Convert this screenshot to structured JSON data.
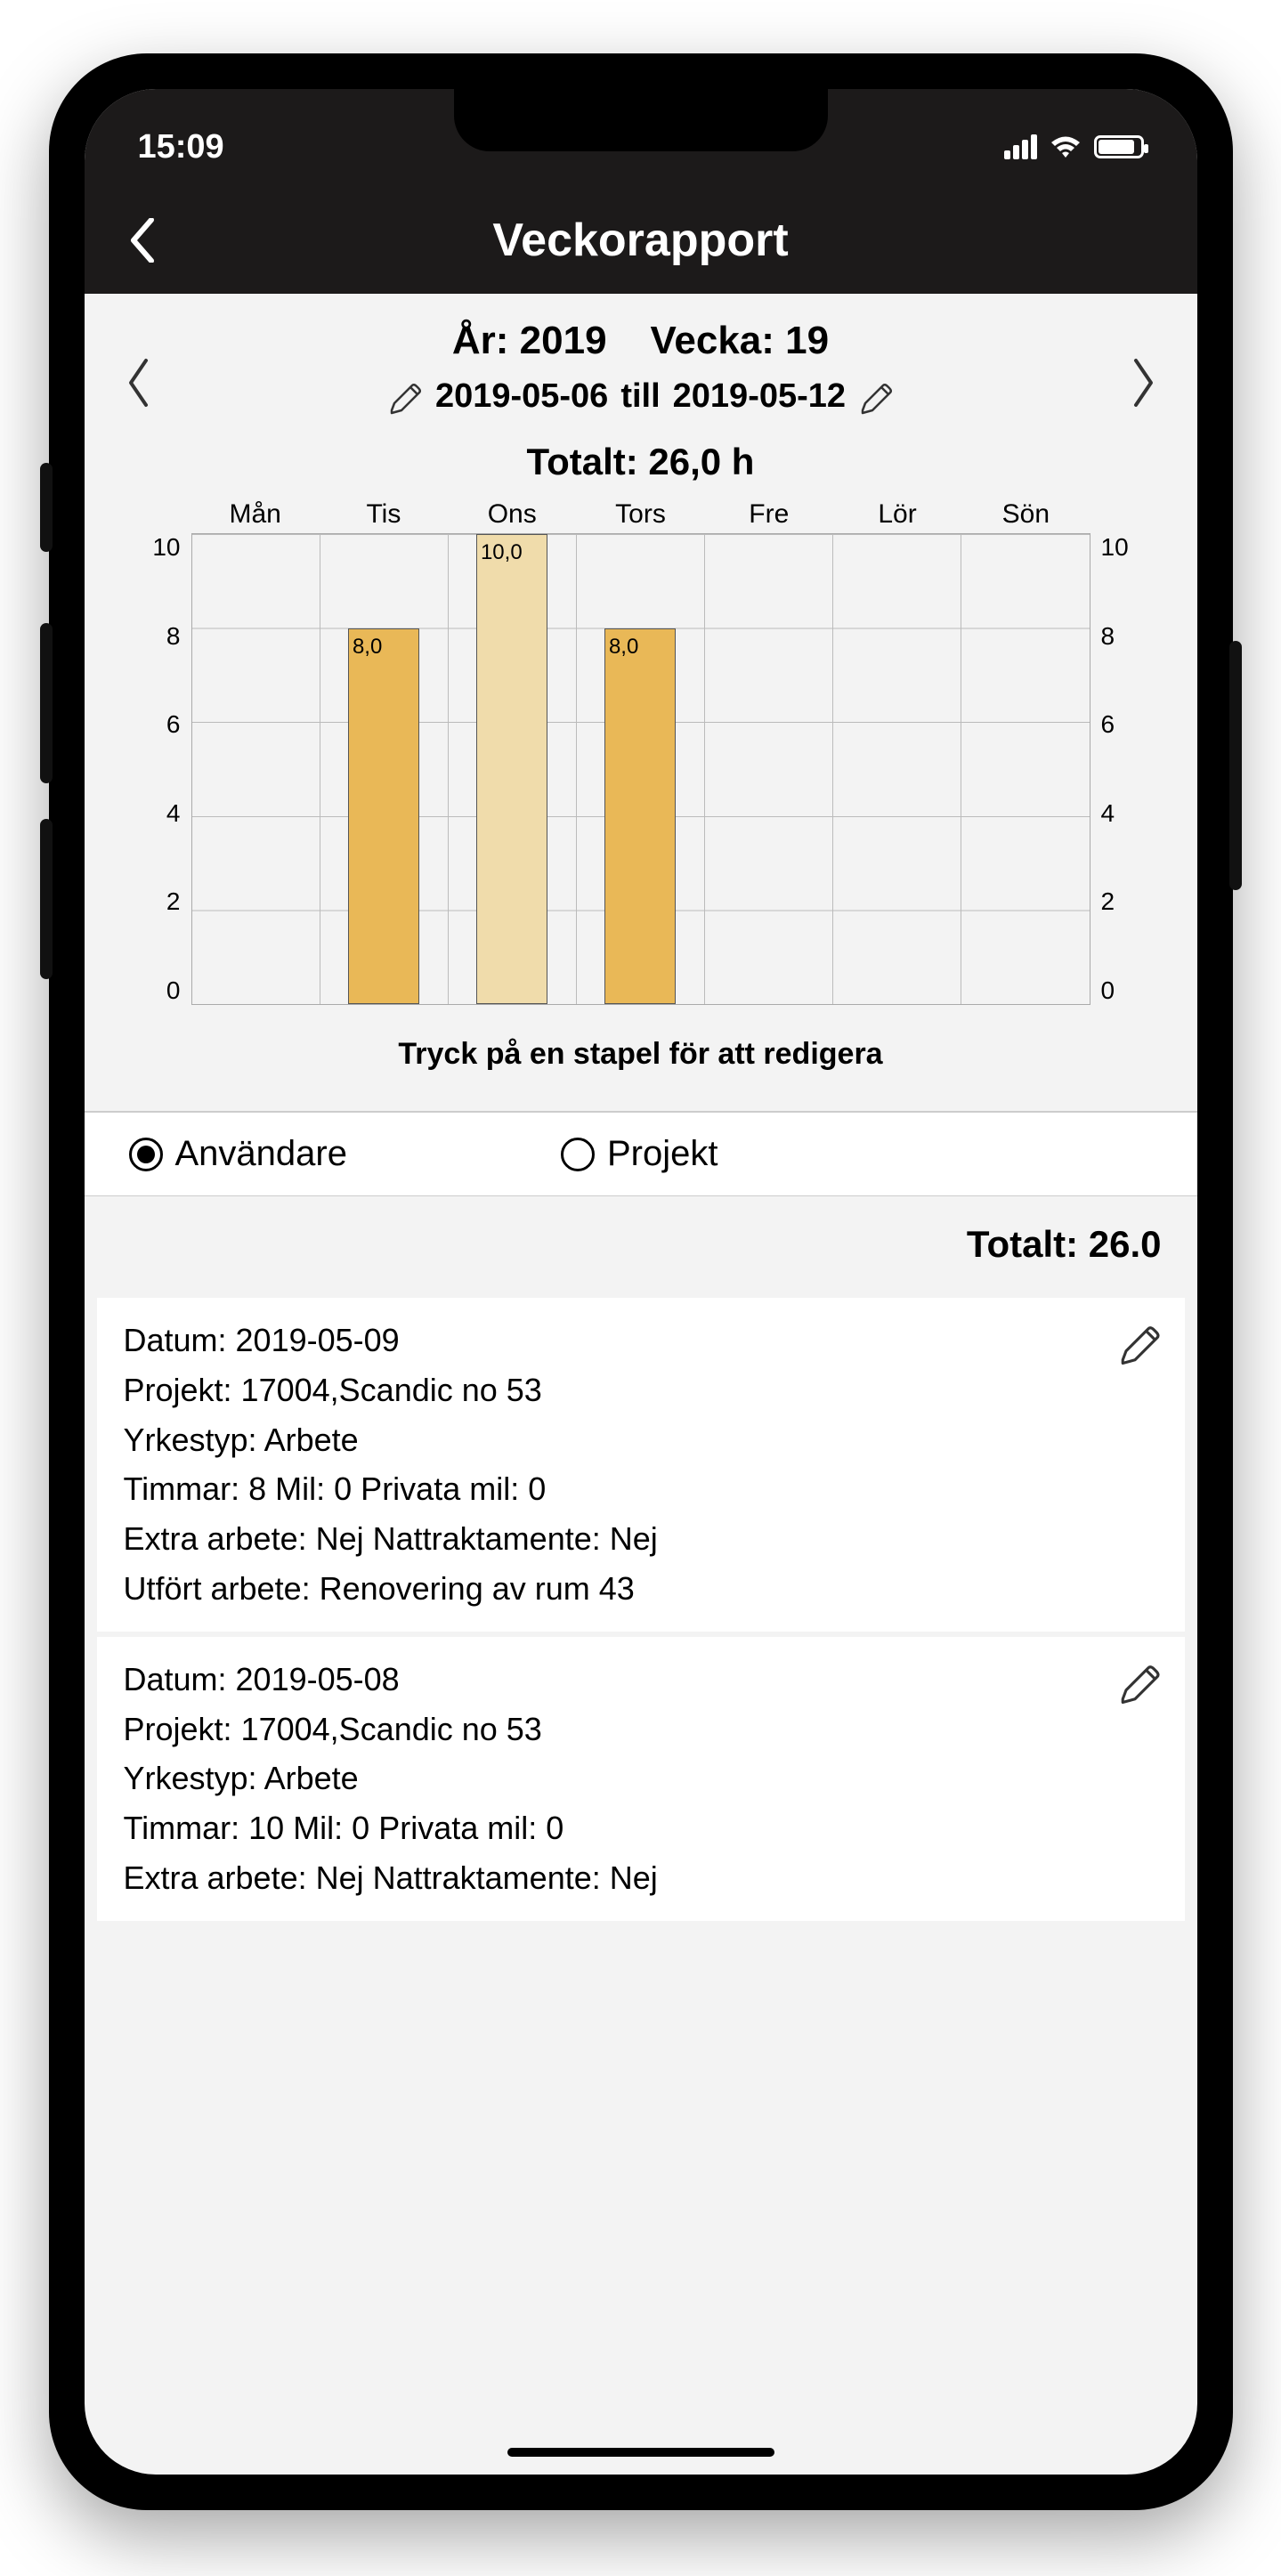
{
  "status": {
    "time": "15:09"
  },
  "title": "Veckorapport",
  "header": {
    "year_label": "År: 2019",
    "week_label": "Vecka: 19",
    "date_from": "2019-05-06",
    "date_sep": "till",
    "date_to": "2019-05-12",
    "total": "Totalt: 26,0 h"
  },
  "chart_data": {
    "type": "bar",
    "categories": [
      "Mån",
      "Tis",
      "Ons",
      "Tors",
      "Fre",
      "Lör",
      "Sön"
    ],
    "series": [
      {
        "name": "Timmar",
        "values": [
          null,
          8.0,
          10.0,
          8.0,
          null,
          null,
          null
        ],
        "labels": [
          "",
          "8,0",
          "10,0",
          "8,0",
          "",
          "",
          ""
        ],
        "colors": [
          "",
          "#e9b857",
          "#f0dcab",
          "#e9b857",
          "",
          "",
          ""
        ]
      }
    ],
    "ylabel": "",
    "xlabel": "",
    "ylim": [
      0,
      10
    ],
    "y_ticks": [
      10,
      8,
      6,
      4,
      2,
      0
    ],
    "hint": "Tryck på en stapel för att redigera"
  },
  "view_toggle": {
    "user": "Användare",
    "project": "Projekt",
    "selected": "user"
  },
  "list": {
    "total_label": "Totalt: 26.0",
    "entries": [
      {
        "date": "Datum: 2019-05-09",
        "project": "Projekt: 17004,Scandic no 53",
        "worktype": "Yrkestyp: Arbete",
        "hours": "Timmar: 8 Mil: 0 Privata mil: 0",
        "extra": "Extra arbete: Nej  Nattraktamente: Nej",
        "done": "Utfört arbete: Renovering av rum 43"
      },
      {
        "date": "Datum: 2019-05-08",
        "project": "Projekt: 17004,Scandic no 53",
        "worktype": "Yrkestyp: Arbete",
        "hours": "Timmar: 10 Mil: 0 Privata mil: 0",
        "extra": "Extra arbete: Nej  Nattraktamente: Nej",
        "done": ""
      }
    ]
  }
}
